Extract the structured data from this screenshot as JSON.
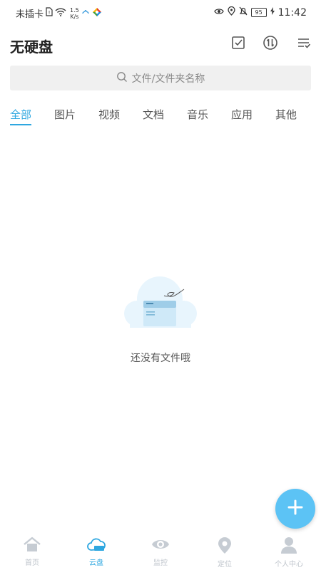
{
  "status_bar": {
    "carrier": "未插卡",
    "speed_value": "1.5",
    "speed_unit": "K/s",
    "battery": "95",
    "time": "11:42"
  },
  "header": {
    "title": "无硬盘",
    "icons": [
      "checkbox-icon",
      "transfer-icon",
      "sort-icon"
    ]
  },
  "search": {
    "placeholder": "文件/文件夹名称"
  },
  "tabs": [
    {
      "label": "全部",
      "active": true
    },
    {
      "label": "图片",
      "active": false
    },
    {
      "label": "视频",
      "active": false
    },
    {
      "label": "文档",
      "active": false
    },
    {
      "label": "音乐",
      "active": false
    },
    {
      "label": "应用",
      "active": false
    },
    {
      "label": "其他",
      "active": false
    }
  ],
  "empty_state": {
    "message": "还没有文件哦"
  },
  "bottom_nav": [
    {
      "label": "首页",
      "icon": "home-icon",
      "active": false
    },
    {
      "label": "云盘",
      "icon": "cloud-icon",
      "active": true
    },
    {
      "label": "监控",
      "icon": "eye-icon",
      "active": false
    },
    {
      "label": "定位",
      "icon": "location-icon",
      "active": false
    },
    {
      "label": "个人中心",
      "icon": "person-icon",
      "active": false
    }
  ],
  "colors": {
    "accent": "#2ea7e0",
    "fab": "#5cc3f5",
    "inactive_nav": "#bfc5cc"
  }
}
